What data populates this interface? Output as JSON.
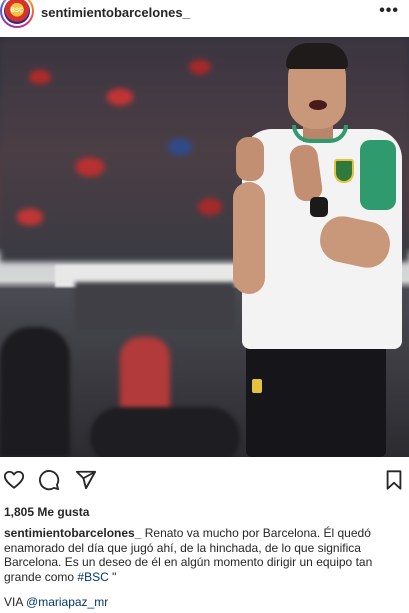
{
  "header": {
    "username": "sentimientobarcelones_",
    "more_label": "•••",
    "avatar_icon": "team-crest-avatar"
  },
  "post": {
    "image_alt": "coach-photo"
  },
  "actions": {
    "like_icon": "heart-icon",
    "comment_icon": "comment-icon",
    "share_icon": "send-icon",
    "save_icon": "bookmark-icon"
  },
  "likes": {
    "label": "1,805 Me gusta"
  },
  "caption": {
    "username": "sentimientobarcelones_",
    "text": " Renato va mucho por Barcelona. Él quedó enamorado del día que jugó ahí, de la hinchada, de lo que significa Barcelona. Es un deseo de él en algún momento dirigir un equipo tan grande como ",
    "hashtag": "#BSC",
    "tail": " \"",
    "via_prefix": "VIA ",
    "via_mention": "@mariapaz_mr"
  },
  "colors": {
    "link": "#00376b",
    "text": "#262626",
    "jersey_accent": "#2e9a6e"
  }
}
